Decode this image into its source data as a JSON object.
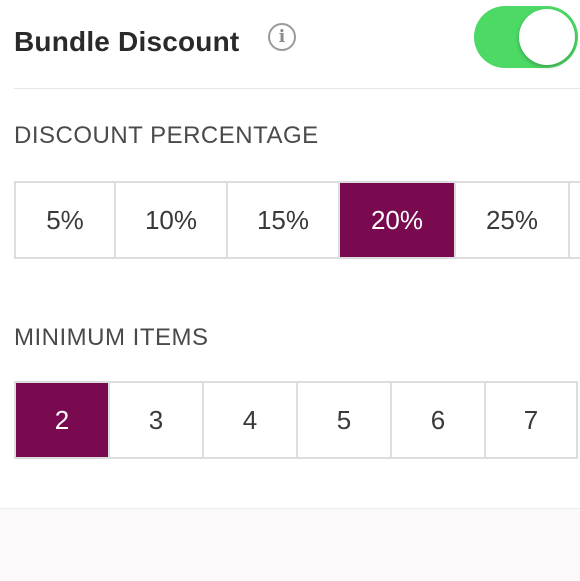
{
  "header": {
    "title": "Bundle Discount",
    "info_icon": "info-icon",
    "toggle": {
      "state": "on",
      "on_color": "#4cd964"
    }
  },
  "discount": {
    "label": "DISCOUNT PERCENTAGE",
    "options": [
      "5%",
      "10%",
      "15%",
      "20%",
      "25%"
    ],
    "selected": "20%"
  },
  "minimum_items": {
    "label": "MINIMUM ITEMS",
    "options": [
      "2",
      "3",
      "4",
      "5",
      "6",
      "7"
    ],
    "selected": "2"
  },
  "colors": {
    "accent": "#7a0a4f",
    "border": "#dddddd"
  }
}
